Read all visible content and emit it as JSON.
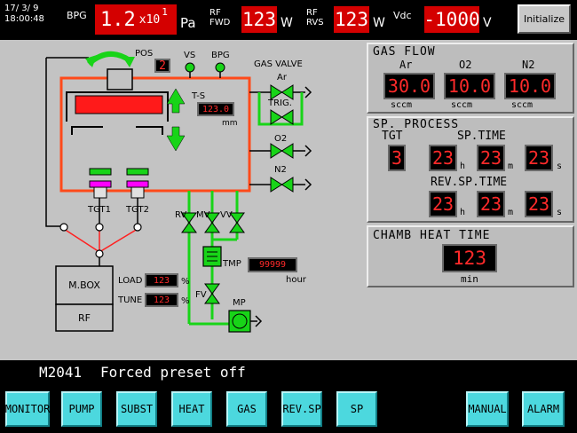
{
  "header": {
    "date": "17/ 3/ 9",
    "time": "18:00:48",
    "bpg_label": "BPG",
    "bpg_mantissa": "1.2",
    "bpg_mult": "x10",
    "bpg_exp": "1",
    "bpg_unit": "Pa",
    "rf_fwd_label_1": "RF",
    "rf_fwd_label_2": "FWD",
    "rf_fwd_value": "123",
    "rf_fwd_unit": "W",
    "rf_rvs_label_1": "RF",
    "rf_rvs_label_2": "RVS",
    "rf_rvs_value": "123",
    "rf_rvs_unit": "W",
    "vdc_label": "Vdc",
    "vdc_value": "-1000",
    "vdc_unit": "V",
    "initialize_label": "Initialize"
  },
  "diagram": {
    "pos_label": "POS",
    "pos_value": "2",
    "vs_label": "VS",
    "bpg_label": "BPG",
    "gas_valve_label": "GAS VALVE",
    "ar_label": "Ar",
    "trig_label": "TRIG.",
    "o2_label": "O2",
    "n2_label": "N2",
    "ts_label": "T-S",
    "ts_value": "123.0",
    "ts_unit": "mm",
    "tgt1_label": "TGT1",
    "tgt2_label": "TGT2",
    "rv_label": "RV",
    "mv_label": "MV",
    "vv_label": "VV",
    "tmp_label": "TMP",
    "tmp_value": "99999",
    "hour_label": "hour",
    "fv_label": "FV",
    "mp_label": "MP",
    "mbox_label": "M.BOX",
    "rf_label": "RF",
    "load_label": "LOAD",
    "load_value": "123",
    "tune_label": "TUNE",
    "tune_value": "123",
    "percent": "%"
  },
  "gas_flow": {
    "title": "GAS FLOW",
    "ar_label": "Ar",
    "o2_label": "O2",
    "n2_label": "N2",
    "ar_value": "30.0",
    "o2_value": "10.0",
    "n2_value": "10.0",
    "unit": "sccm"
  },
  "sp_process": {
    "title": "SP. PROCESS",
    "tgt_label": "TGT",
    "tgt_value": "3",
    "sp_time_label": "SP.TIME",
    "sp_h": "23",
    "sp_m": "23",
    "sp_s": "23",
    "rev_sp_time_label": "REV.SP.TIME",
    "rev_h": "23",
    "rev_m": "23",
    "rev_s": "23",
    "h": "h",
    "m": "m",
    "s": "s"
  },
  "chamb_heat": {
    "title": "CHAMB HEAT TIME",
    "value": "123",
    "unit": "min"
  },
  "status": {
    "code": "M2041",
    "message": "Forced preset off"
  },
  "nav": {
    "monitor": "MONITOR",
    "pump": "PUMP",
    "subst": "SUBST",
    "heat": "HEAT",
    "gas": "GAS",
    "rev_sp": "REV.SP",
    "sp": "SP",
    "manual": "MANUAL",
    "alarm": "ALARM"
  },
  "colors": {
    "background": "#c3c3c3",
    "chamber_border": "#ff4a1a",
    "valve_green": "#1edc1e",
    "nav_button": "#4cd8de",
    "readout_red": "#ff2a2a"
  }
}
